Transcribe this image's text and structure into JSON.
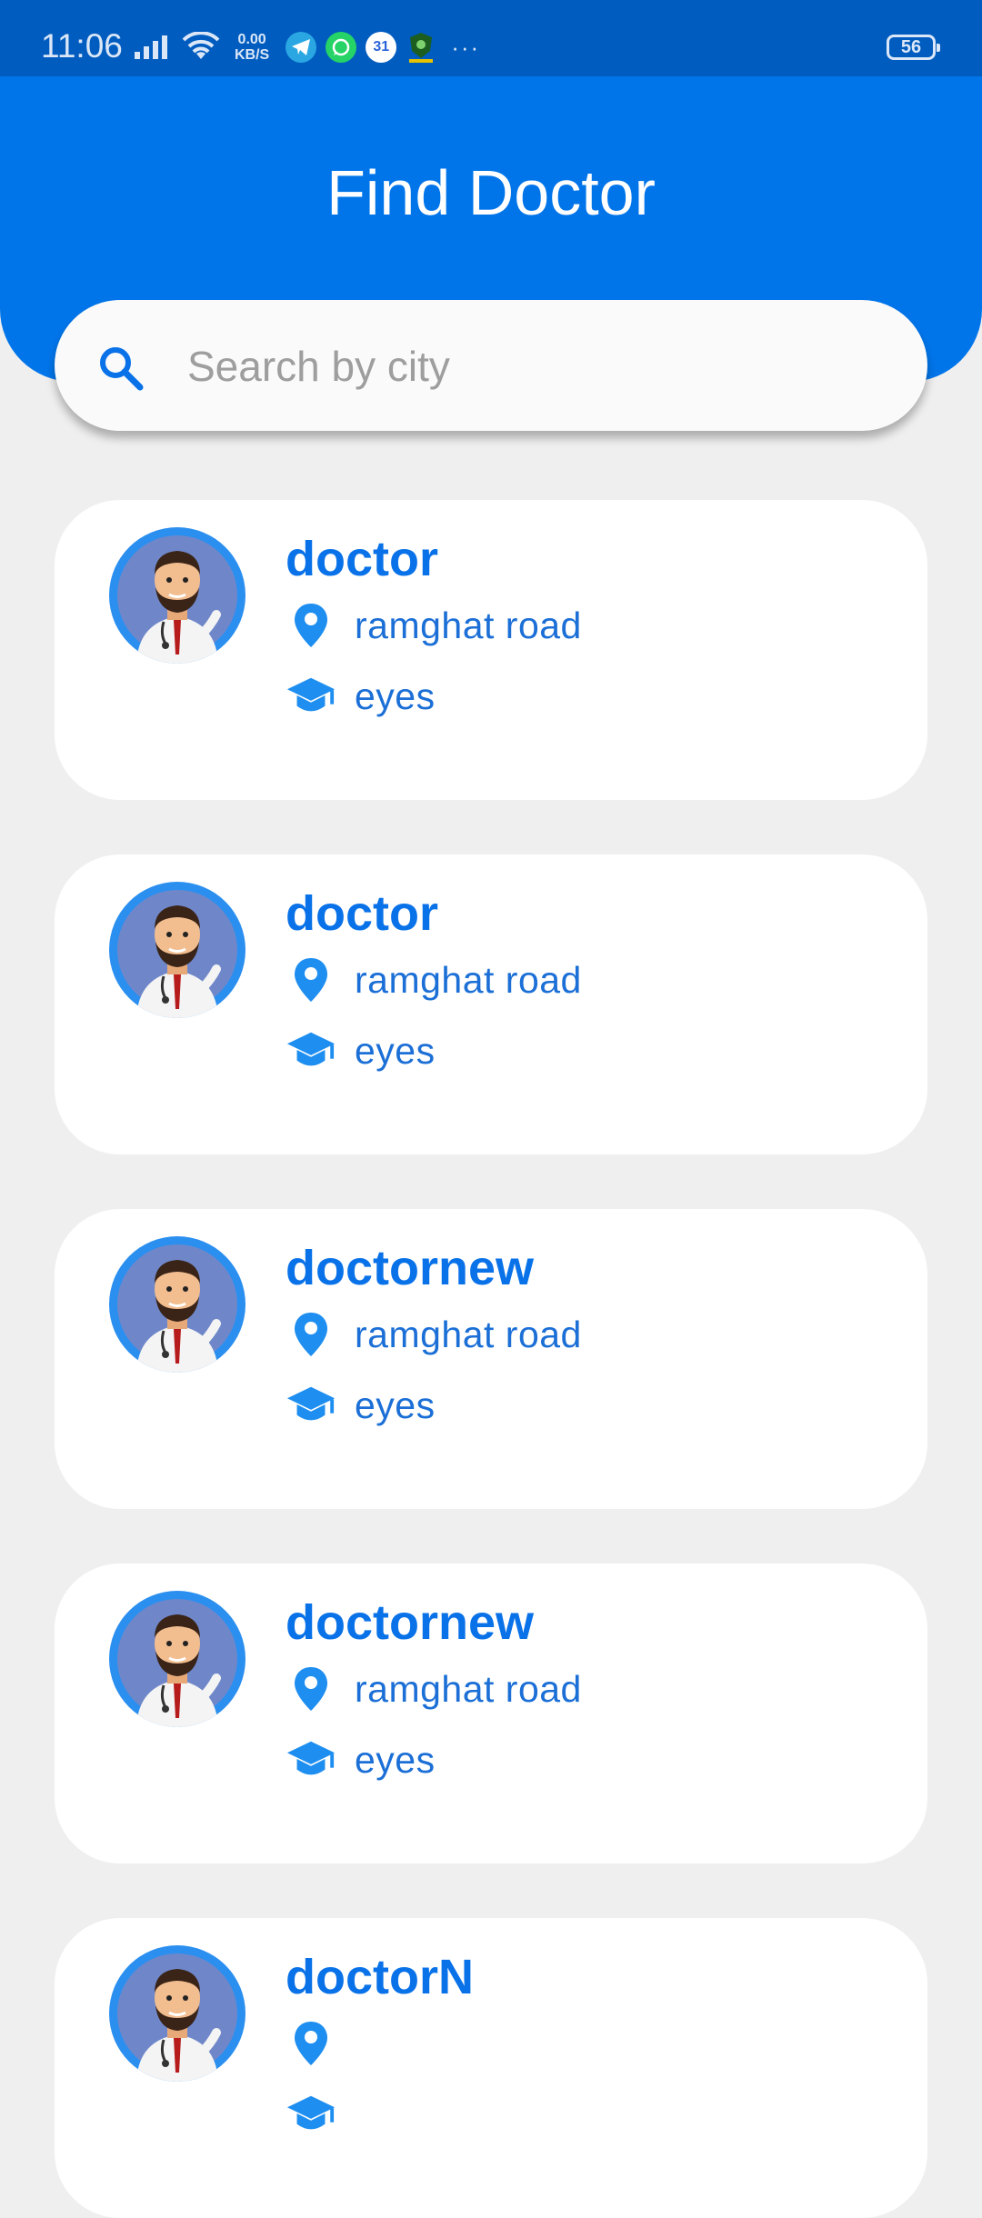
{
  "status_bar": {
    "time": "11:06",
    "net_speed_value": "0.00",
    "net_speed_unit": "KB/S",
    "calendar_day": "31",
    "more": "···",
    "battery": "56"
  },
  "header": {
    "title": "Find Doctor"
  },
  "search": {
    "placeholder": "Search by city",
    "value": ""
  },
  "doctors": [
    {
      "name": "doctor",
      "location": "ramghat road",
      "specialty": "eyes"
    },
    {
      "name": "doctor",
      "location": "ramghat road",
      "specialty": "eyes"
    },
    {
      "name": "doctornew",
      "location": "ramghat road",
      "specialty": "eyes"
    },
    {
      "name": "doctornew",
      "location": "ramghat road",
      "specialty": "eyes"
    },
    {
      "name": "doctorN",
      "location": "",
      "specialty": ""
    }
  ],
  "colors": {
    "primary": "#0075ea",
    "status_bar": "#005cbf",
    "background": "#efefef",
    "accent_text": "#0a72e8"
  },
  "icons": {
    "search": "search-icon",
    "location": "location-pin-icon",
    "specialty": "graduation-cap-icon",
    "avatar": "doctor-avatar-icon"
  }
}
